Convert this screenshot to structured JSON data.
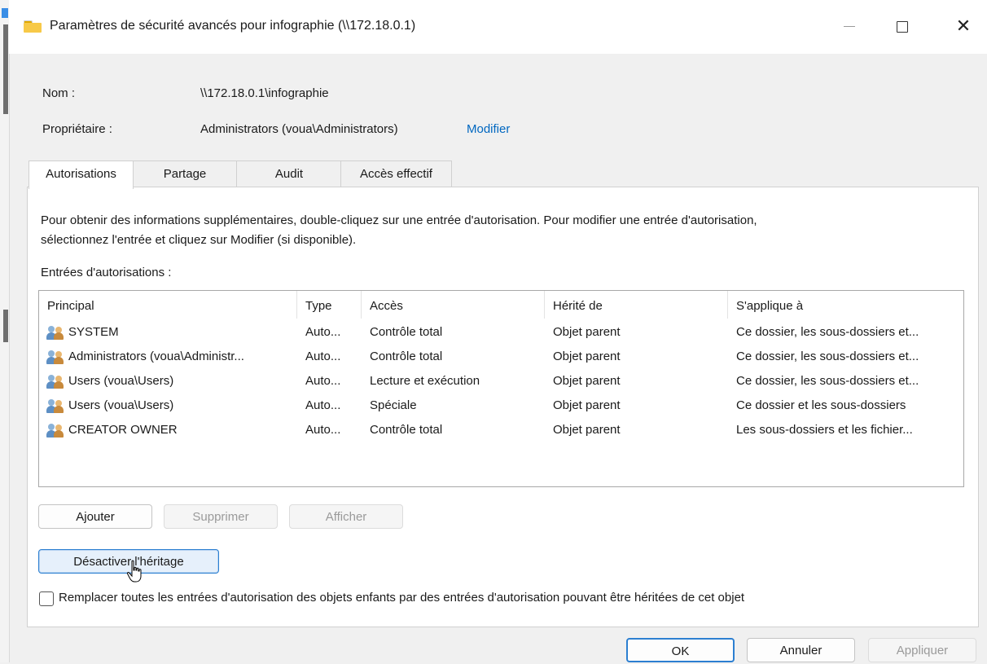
{
  "window": {
    "title": "Paramètres de sécurité avancés pour infographie (\\\\172.18.0.1)",
    "close_glyph": "✕"
  },
  "info": {
    "name_label": "Nom :",
    "name_value": "\\\\172.18.0.1\\infographie",
    "owner_label": "Propriétaire :",
    "owner_value": "Administrators (voua\\Administrators)",
    "owner_link": "Modifier"
  },
  "tabs": [
    {
      "label": "Autorisations",
      "active": true
    },
    {
      "label": "Partage"
    },
    {
      "label": "Audit"
    },
    {
      "label": "Accès effectif"
    }
  ],
  "panel": {
    "info_line1": "Pour obtenir des informations supplémentaires, double-cliquez sur une entrée d'autorisation. Pour modifier une entrée d'autorisation,",
    "info_line2": "sélectionnez l'entrée et cliquez sur Modifier (si disponible).",
    "entries_label": "Entrées d'autorisations :"
  },
  "table": {
    "columns": [
      "Principal",
      "Type",
      "Accès",
      "Hérité de",
      "S'applique à"
    ],
    "rows": [
      {
        "principal": "SYSTEM",
        "type": "Auto...",
        "access": "Contrôle total",
        "inherited": "Objet parent",
        "applies": "Ce dossier, les sous-dossiers et..."
      },
      {
        "principal": "Administrators (voua\\Administr...",
        "type": "Auto...",
        "access": "Contrôle total",
        "inherited": "Objet parent",
        "applies": "Ce dossier, les sous-dossiers et..."
      },
      {
        "principal": "Users (voua\\Users)",
        "type": "Auto...",
        "access": "Lecture et exécution",
        "inherited": "Objet parent",
        "applies": "Ce dossier, les sous-dossiers et..."
      },
      {
        "principal": "Users (voua\\Users)",
        "type": "Auto...",
        "access": "Spéciale",
        "inherited": "Objet parent",
        "applies": "Ce dossier et les sous-dossiers"
      },
      {
        "principal": "CREATOR OWNER",
        "type": "Auto...",
        "access": "Contrôle total",
        "inherited": "Objet parent",
        "applies": "Les sous-dossiers et les fichier..."
      }
    ]
  },
  "buttons": {
    "add": "Ajouter",
    "remove": "Supprimer",
    "view": "Afficher",
    "disable_inheritance": "Désactiver l'héritage",
    "ok": "OK",
    "cancel": "Annuler",
    "apply": "Appliquer"
  },
  "checkbox": {
    "label": "Remplacer toutes les entrées d'autorisation des objets enfants par des entrées d'autorisation pouvant être héritées de cet objet",
    "checked": false
  },
  "colors": {
    "link": "#0067c0",
    "accent": "#2c7fd1"
  }
}
